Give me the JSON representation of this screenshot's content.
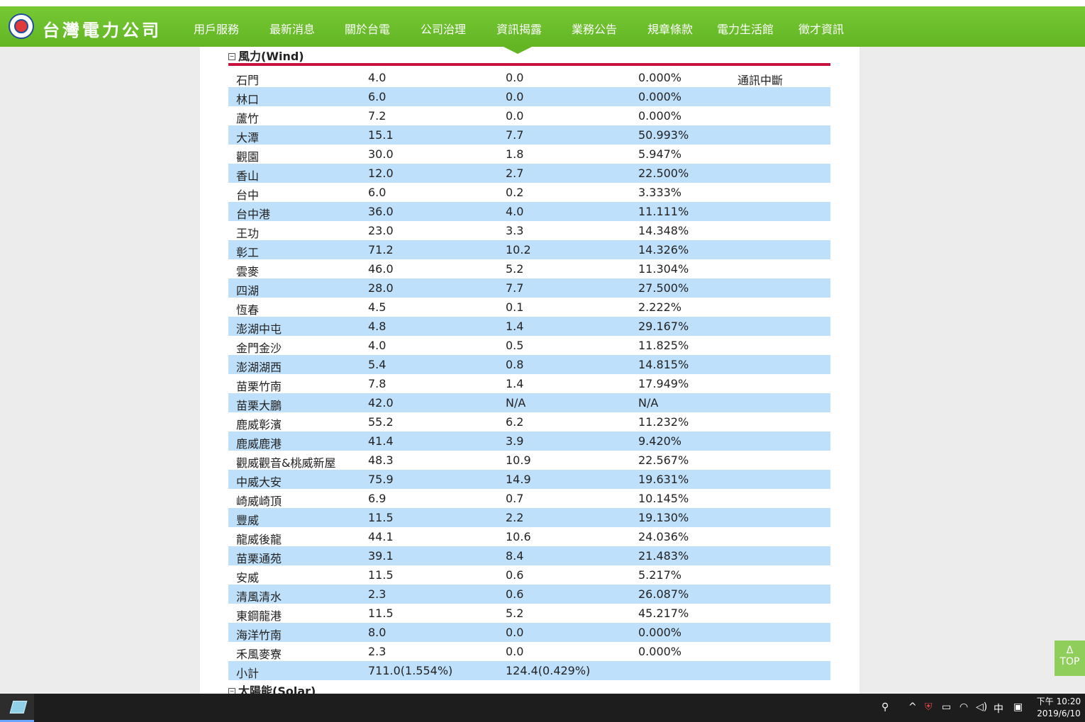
{
  "header": {
    "logo_text": "台灣電力公司",
    "nav": [
      "用戶服務",
      "最新消息",
      "關於台電",
      "公司治理",
      "資訊揭露",
      "業務公告",
      "規章條款",
      "電力生活館",
      "徵才資訊"
    ]
  },
  "wind_section": {
    "title": "風力(Wind)",
    "toggle": "⊟",
    "rows": [
      [
        "石門",
        "4.0",
        "0.0",
        "0.000%",
        "通訊中斷"
      ],
      [
        "林口",
        "6.0",
        "0.0",
        "0.000%",
        ""
      ],
      [
        "蘆竹",
        "7.2",
        "0.0",
        "0.000%",
        ""
      ],
      [
        "大潭",
        "15.1",
        "7.7",
        "50.993%",
        ""
      ],
      [
        "觀園",
        "30.0",
        "1.8",
        "5.947%",
        ""
      ],
      [
        "香山",
        "12.0",
        "2.7",
        "22.500%",
        ""
      ],
      [
        "台中",
        "6.0",
        "0.2",
        "3.333%",
        ""
      ],
      [
        "台中港",
        "36.0",
        "4.0",
        "11.111%",
        ""
      ],
      [
        "王功",
        "23.0",
        "3.3",
        "14.348%",
        ""
      ],
      [
        "彰工",
        "71.2",
        "10.2",
        "14.326%",
        ""
      ],
      [
        "雲麥",
        "46.0",
        "5.2",
        "11.304%",
        ""
      ],
      [
        "四湖",
        "28.0",
        "7.7",
        "27.500%",
        ""
      ],
      [
        "恆春",
        "4.5",
        "0.1",
        "2.222%",
        ""
      ],
      [
        "澎湖中屯",
        "4.8",
        "1.4",
        "29.167%",
        ""
      ],
      [
        "金門金沙",
        "4.0",
        "0.5",
        "11.825%",
        ""
      ],
      [
        "澎湖湖西",
        "5.4",
        "0.8",
        "14.815%",
        ""
      ],
      [
        "苗栗竹南",
        "7.8",
        "1.4",
        "17.949%",
        ""
      ],
      [
        "苗栗大鵬",
        "42.0",
        "N/A",
        "N/A",
        ""
      ],
      [
        "鹿威彰濱",
        "55.2",
        "6.2",
        "11.232%",
        ""
      ],
      [
        "鹿威鹿港",
        "41.4",
        "3.9",
        "9.420%",
        ""
      ],
      [
        "觀威觀音&桃威新屋",
        "48.3",
        "10.9",
        "22.567%",
        ""
      ],
      [
        "中威大安",
        "75.9",
        "14.9",
        "19.631%",
        ""
      ],
      [
        "崎威崎頂",
        "6.9",
        "0.7",
        "10.145%",
        ""
      ],
      [
        "豐威",
        "11.5",
        "2.2",
        "19.130%",
        ""
      ],
      [
        "龍威後龍",
        "44.1",
        "10.6",
        "24.036%",
        ""
      ],
      [
        "苗栗通苑",
        "39.1",
        "8.4",
        "21.483%",
        ""
      ],
      [
        "安威",
        "11.5",
        "0.6",
        "5.217%",
        ""
      ],
      [
        "清風清水",
        "2.3",
        "0.6",
        "26.087%",
        ""
      ],
      [
        "東鋼龍港",
        "11.5",
        "5.2",
        "45.217%",
        ""
      ],
      [
        "海洋竹南",
        "8.0",
        "0.0",
        "0.000%",
        ""
      ],
      [
        "禾風麥寮",
        "2.3",
        "0.0",
        "0.000%",
        ""
      ],
      [
        "小計",
        "711.0(1.554%)",
        "124.4(0.429%)",
        "",
        ""
      ]
    ]
  },
  "solar_section": {
    "title": "太陽能(Solar)",
    "toggle": "⊟"
  },
  "top_button": {
    "arrow": "Δ",
    "label": "TOP"
  },
  "taskbar": {
    "tray_icons": [
      "people-icon",
      "chevron-up-icon",
      "shield-icon",
      "battery-icon",
      "wifi-icon",
      "volume-icon",
      "ime-icon",
      "notification-icon"
    ],
    "ime": "中",
    "time": "下午 10:20",
    "date": "2019/6/10"
  },
  "colors": {
    "nav_green": "#6abf2c",
    "row_alt": "#bfe0fb",
    "section_line": "#c8123f"
  }
}
